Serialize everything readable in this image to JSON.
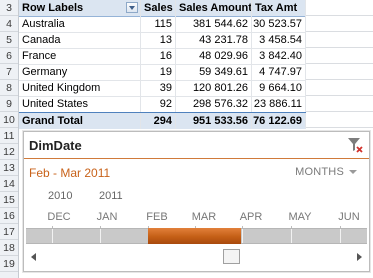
{
  "row_numbers": [
    "3",
    "4",
    "5",
    "6",
    "7",
    "8",
    "9",
    "10",
    "11",
    "12",
    "13",
    "14",
    "15",
    "16",
    "17",
    "18",
    "19"
  ],
  "pivot": {
    "headers": [
      "Row Labels",
      "Sales",
      "Sales Amount",
      "Tax Amt"
    ],
    "rows": [
      {
        "label": "Australia",
        "sales": "115",
        "amount": "381 544.62",
        "tax": "30 523.57"
      },
      {
        "label": "Canada",
        "sales": "13",
        "amount": "43 231.78",
        "tax": "3 458.54"
      },
      {
        "label": "France",
        "sales": "16",
        "amount": "48 029.96",
        "tax": "3 842.40"
      },
      {
        "label": "Germany",
        "sales": "19",
        "amount": "59 349.61",
        "tax": "4 747.97"
      },
      {
        "label": "United Kingdom",
        "sales": "39",
        "amount": "120 801.26",
        "tax": "9 664.10"
      },
      {
        "label": "United States",
        "sales": "92",
        "amount": "298 576.32",
        "tax": "23 886.11"
      }
    ],
    "total": {
      "label": "Grand Total",
      "sales": "294",
      "amount": "951 533.56",
      "tax": "76 122.69"
    }
  },
  "timeline": {
    "title": "DimDate",
    "range_label": "Feb - Mar 2011",
    "level": "MONTHS",
    "years": [
      "2010",
      "2011"
    ],
    "months": [
      "DEC",
      "JAN",
      "FEB",
      "MAR",
      "APR",
      "MAY",
      "JUN"
    ],
    "accent_color": "#c8621a"
  }
}
